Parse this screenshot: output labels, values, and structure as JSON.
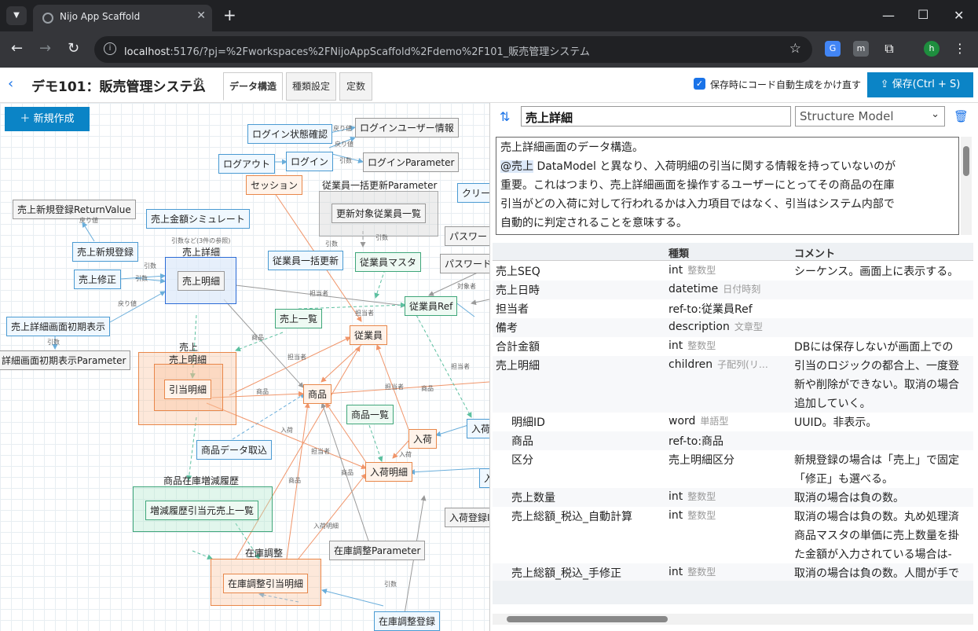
{
  "browser": {
    "tab_title": "Nijo App Scaffold",
    "url_host": "localhost",
    "url_rest": ":5176/?pj=%2Fworkspaces%2FNijoAppScaffold%2Fdemo%2F101_販売管理システム",
    "profile_initial": "h"
  },
  "app": {
    "title": "デモ101：販売管理システム",
    "tabs": [
      "データ構造",
      "種類設定",
      "定数"
    ],
    "autogen_label": "保存時にコード自動生成をかけ直す",
    "save_label": "保存(Ctrl + S)",
    "new_label": "新規作成"
  },
  "graph": {
    "nodes": [
      {
        "label": "ログイン状態確認",
        "style": "blue"
      },
      {
        "label": "ログインユーザー情報",
        "style": "gray"
      },
      {
        "label": "ログアウト",
        "style": "blue"
      },
      {
        "label": "ログイン",
        "style": "blue"
      },
      {
        "label": "ログインParameter",
        "style": "gray"
      },
      {
        "label": "セッション",
        "style": "orange"
      },
      {
        "label": "売上新規登録ReturnValue",
        "style": "gray"
      },
      {
        "label": "売上金額シミュレート",
        "style": "blue"
      },
      {
        "label": "更新対象従業員一覧",
        "style": "gray"
      },
      {
        "label": "クリー",
        "style": "blue"
      },
      {
        "label": "パスワー",
        "style": "gray"
      },
      {
        "label": "売上新規登録",
        "style": "blue"
      },
      {
        "label": "従業員マスタ",
        "style": "green"
      },
      {
        "label": "パスワード",
        "style": "gray"
      },
      {
        "label": "従業員一括更新",
        "style": "blue"
      },
      {
        "label": "売上修正",
        "style": "blue"
      },
      {
        "label": "売上明細",
        "style": "selected"
      },
      {
        "label": "従業員Ref",
        "style": "green"
      },
      {
        "label": "売上一覧",
        "style": "green"
      },
      {
        "label": "売上詳細画面初期表示",
        "style": "blue"
      },
      {
        "label": "従業員",
        "style": "orange"
      },
      {
        "label": "詳細画面初期表示Parameter",
        "style": "gray"
      },
      {
        "label": "引当明細",
        "style": "orange"
      },
      {
        "label": "商品",
        "style": "orange"
      },
      {
        "label": "商品一覧",
        "style": "green"
      },
      {
        "label": "入荷",
        "style": "blue"
      },
      {
        "label": "入荷",
        "style": "orange"
      },
      {
        "label": "商品データ取込",
        "style": "blue"
      },
      {
        "label": "入荷明細",
        "style": "orange"
      },
      {
        "label": "入",
        "style": "blue"
      },
      {
        "label": "増減履歴引当元売上一覧",
        "style": "green"
      },
      {
        "label": "入荷登録I",
        "style": "gray"
      },
      {
        "label": "在庫調整Parameter",
        "style": "gray"
      },
      {
        "label": "在庫調整引当明細",
        "style": "orange"
      },
      {
        "label": "在庫調整登録",
        "style": "blue"
      }
    ],
    "groups": [
      "従業員一括更新Parameter",
      "売上詳細",
      "売上",
      "売上明細",
      "商品在庫増減履歴",
      "在庫調整"
    ],
    "edge_labels": [
      "戻り値",
      "戻り値",
      "引数",
      "戻り値",
      "引数",
      "引数",
      "引数",
      "引数など(3件の参照)",
      "引数",
      "戻り値",
      "引数",
      "担当者",
      "対象者",
      "担当者",
      "商品",
      "担当者",
      "担当者",
      "商品",
      "担当者",
      "商品",
      "入荷",
      "入荷",
      "担当者",
      "商品",
      "商品",
      "入荷明細",
      "引数"
    ]
  },
  "detail": {
    "name": "売上詳細",
    "model_type": "Structure Model",
    "description_lines": [
      {
        "text": "売上詳細画面のデータ構造。"
      },
      {
        "mention": "@売上",
        "text": " DataModel と異なり、入荷明細の引当に関する情報を持っていないのが"
      },
      {
        "text": "重要。これはつまり、売上詳細画面を操作するユーザーにとってその商品の在庫"
      },
      {
        "text": "引当がどの入荷に対して行われるかは入力項目ではなく、引当はシステム内部で"
      },
      {
        "text": "自動的に判定されることを意味する。"
      }
    ],
    "columns": [
      "",
      "種類",
      "コメント"
    ],
    "rows": [
      {
        "indent": 0,
        "name": "売上SEQ",
        "type": "int",
        "type_name": "整数型",
        "comment": [
          "シーケンス。画面上に表示する。"
        ]
      },
      {
        "indent": 0,
        "name": "売上日時",
        "type": "datetime",
        "type_name": "日付時刻",
        "comment": []
      },
      {
        "indent": 0,
        "name": "担当者",
        "type": "ref-to:従業員Ref",
        "type_name": "",
        "comment": []
      },
      {
        "indent": 0,
        "name": "備考",
        "type": "description",
        "type_name": "文章型",
        "comment": []
      },
      {
        "indent": 0,
        "name": "合計金額",
        "type": "int",
        "type_name": "整数型",
        "comment": [
          "DBには保存しないが画面上での"
        ]
      },
      {
        "indent": 0,
        "name": "売上明細",
        "type": "children",
        "type_name": "子配列(リ…",
        "comment": [
          "引当のロジックの都合上、一度登",
          "新や削除ができない。取消の場合",
          "追加していく。"
        ]
      },
      {
        "indent": 1,
        "name": "明細ID",
        "type": "word",
        "type_name": "単語型",
        "comment": [
          "UUID。非表示。"
        ]
      },
      {
        "indent": 1,
        "name": "商品",
        "type": "ref-to:商品",
        "type_name": "",
        "comment": []
      },
      {
        "indent": 1,
        "name": "区分",
        "type": "売上明細区分",
        "type_name": "",
        "comment": [
          "新規登録の場合は「売上」で固定",
          "「修正」も選べる。"
        ]
      },
      {
        "indent": 1,
        "name": "売上数量",
        "type": "int",
        "type_name": "整数型",
        "comment": [
          "取消の場合は負の数。"
        ]
      },
      {
        "indent": 1,
        "name": "売上総額_税込_自動計算",
        "type": "int",
        "type_name": "整数型",
        "comment": [
          "取消の場合は負の数。丸め処理済",
          "商品マスタの単価に売上数量を掛",
          "た金額が入力されている場合は-"
        ]
      },
      {
        "indent": 1,
        "name": "売上総額_税込_手修正",
        "type": "int",
        "type_name": "整数型",
        "comment": [
          "取消の場合は負の数。人間が手で"
        ]
      }
    ]
  }
}
